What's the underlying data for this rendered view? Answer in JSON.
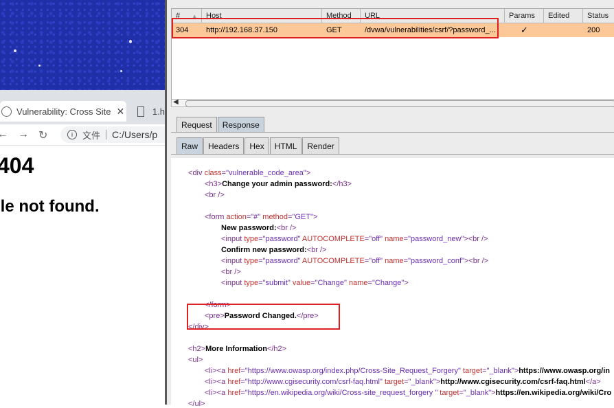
{
  "browser": {
    "tabs": [
      {
        "title": "Vulnerability: Cross Site",
        "close": "✕"
      },
      {
        "title": "1.h"
      }
    ],
    "address": {
      "label": "文件",
      "path": "C:/Users/p"
    },
    "page": {
      "heading": "404",
      "subheading": "ile not found."
    }
  },
  "proxy_table": {
    "columns": [
      "#",
      "Host",
      "Method",
      "URL",
      "Params",
      "Edited",
      "Status"
    ],
    "sort_indicator": "▲",
    "row": {
      "num": "304",
      "host": "http://192.168.37.150",
      "method": "GET",
      "url": "/dvwa/vulnerabilities/csrf/?password_...",
      "params": "✓",
      "edited": "",
      "status": "200"
    }
  },
  "message_tabs": [
    "Request",
    "Response"
  ],
  "view_tabs": [
    "Raw",
    "Headers",
    "Hex",
    "HTML",
    "Render"
  ],
  "code": {
    "div_open": {
      "tag": "div",
      "attr": "class",
      "value": "\"vulnerable_code_area\""
    },
    "h3_text": "Change your admin password:",
    "form_attr1": "action",
    "form_val1": "\"#\"",
    "form_attr2": "method",
    "form_val2": "\"GET\"",
    "new_password": "New password:",
    "input1": {
      "type": "\"password\"",
      "auto": "\"off\"",
      "name": "\"password_new\""
    },
    "confirm_password": "Confirm new password:",
    "input2": {
      "type": "\"password\"",
      "auto": "\"off\"",
      "name": "\"password_conf\""
    },
    "input3": {
      "type": "\"submit\"",
      "value": "\"Change\"",
      "name": "\"Change\""
    },
    "pre_text": "Password Changed.",
    "h2_text": "More Information",
    "links": [
      {
        "href": "\"https://www.owasp.org/index.php/Cross-Site_Request_Forgery\"",
        "target": "\"_blank\"",
        "text": "https://www.owasp.org/in"
      },
      {
        "href": "\"http://www.cgisecurity.com/csrf-faq.html\"",
        "target": "\"_blank\"",
        "text": "http://www.cgisecurity.com/csrf-faq.html"
      },
      {
        "href": "\"https://en.wikipedia.org/wiki/Cross-site_request_forgery \"",
        "target": "\"_blank\"",
        "text": "https://en.wikipedia.org/wiki/Cro"
      }
    ]
  }
}
